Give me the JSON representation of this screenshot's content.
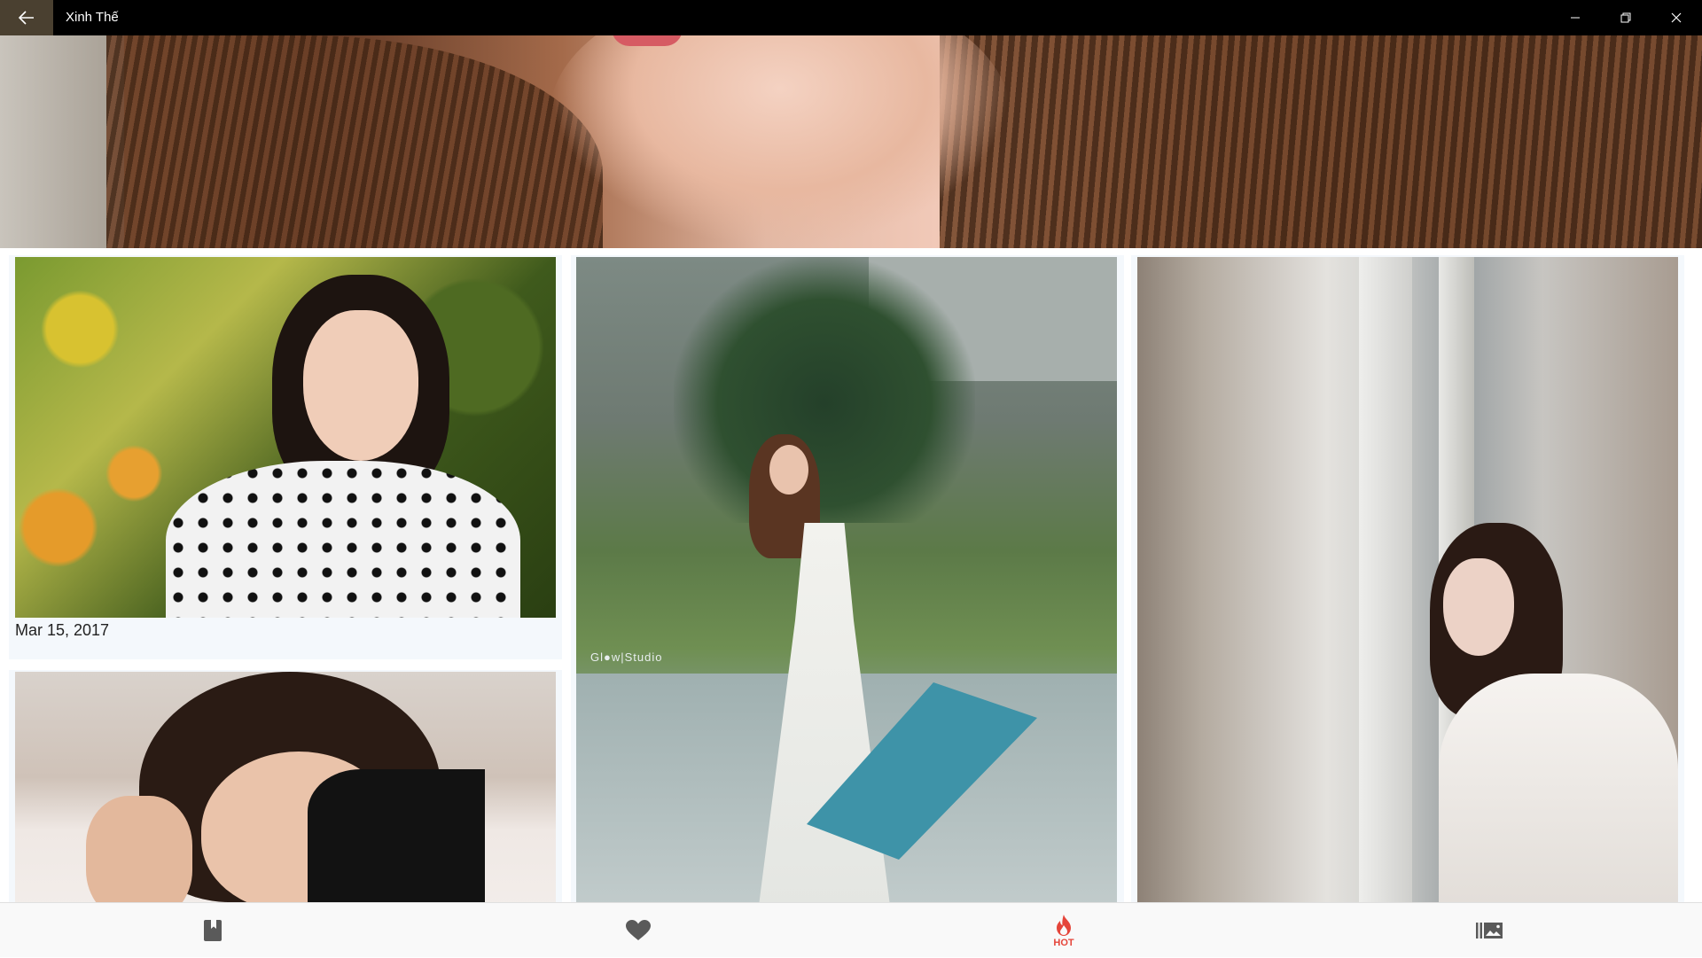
{
  "window": {
    "title": "Xinh Thế",
    "back_icon": "arrow-left-icon",
    "minimize_icon": "minimize-icon",
    "maximize_icon": "restore-icon",
    "close_icon": "close-icon"
  },
  "hero": {
    "image": "hero-banner-image"
  },
  "gallery": {
    "cards": [
      {
        "image": "girl-polka-dot-photo",
        "date": "Mar 15, 2017"
      },
      {
        "image": "girl-umbrella-photo",
        "watermark": "Gl●w|Studio"
      },
      {
        "image": "girl-window-photo"
      },
      {
        "image": "girl-lying-photo"
      }
    ]
  },
  "bottom_nav": {
    "items": [
      {
        "icon": "bookmark-icon",
        "label": ""
      },
      {
        "icon": "heart-icon",
        "label": ""
      },
      {
        "icon": "flame-icon",
        "label": "HOT",
        "active": true
      },
      {
        "icon": "gallery-icon",
        "label": ""
      }
    ]
  },
  "colors": {
    "accent": "#e5453a",
    "titlebar": "#000000",
    "back_button_bg": "#4a4030",
    "nav_icon": "#5a5a5a",
    "card_bg": "#f4f8fc"
  }
}
